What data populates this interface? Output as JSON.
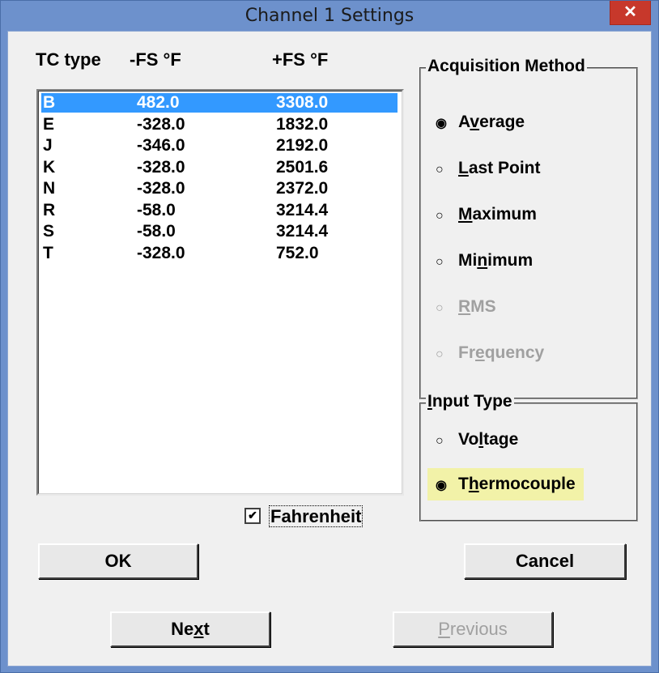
{
  "window": {
    "title": "Channel 1 Settings",
    "close_glyph": "✕"
  },
  "table": {
    "headers": [
      "TC type",
      "-FS °F",
      "+FS °F"
    ],
    "rows": [
      {
        "type": "B",
        "neg": "482.0",
        "pos": "3308.0",
        "selected": true
      },
      {
        "type": "E",
        "neg": "-328.0",
        "pos": "1832.0"
      },
      {
        "type": "J",
        "neg": "-346.0",
        "pos": "2192.0"
      },
      {
        "type": "K",
        "neg": "-328.0",
        "pos": "2501.6"
      },
      {
        "type": "N",
        "neg": "-328.0",
        "pos": "2372.0"
      },
      {
        "type": "R",
        "neg": "-58.0",
        "pos": "3214.4"
      },
      {
        "type": "S",
        "neg": "-58.0",
        "pos": "3214.4"
      },
      {
        "type": "T",
        "neg": "-328.0",
        "pos": "752.0"
      }
    ]
  },
  "fahrenheit": {
    "label": "Fahrenheit",
    "checked": true
  },
  "acquisition": {
    "label": "Acquisition Method",
    "options": [
      {
        "label": "Average",
        "ul": "v",
        "selected": true,
        "enabled": true
      },
      {
        "label": "Last Point",
        "ul": "L",
        "selected": false,
        "enabled": true
      },
      {
        "label": "Maximum",
        "ul": "M",
        "selected": false,
        "enabled": true
      },
      {
        "label": "Minimum",
        "ul": "n",
        "selected": false,
        "enabled": true
      },
      {
        "label": "RMS",
        "ul": "R",
        "selected": false,
        "enabled": false
      },
      {
        "label": "Frequency",
        "ul": "e",
        "selected": false,
        "enabled": false
      }
    ]
  },
  "input_type": {
    "label": "Input Type",
    "options": [
      {
        "label": "Voltage",
        "ul": "l",
        "selected": false
      },
      {
        "label": "Thermocouple",
        "ul": "h",
        "selected": true
      }
    ]
  },
  "buttons": {
    "ok": "OK",
    "cancel": "Cancel",
    "next": "Next",
    "previous": "Previous"
  },
  "icons": {
    "radio_on": "◉",
    "radio_off": "○",
    "check": "✔"
  },
  "colors": {
    "titlebar": "#6d91cc",
    "close": "#c7382b",
    "selection": "#3399ff",
    "highlight": "#f2f2a8"
  }
}
